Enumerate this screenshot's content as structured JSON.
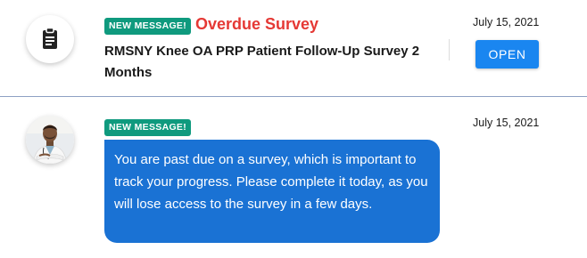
{
  "messages": [
    {
      "badge": "NEW MESSAGE!",
      "title": "Overdue Survey",
      "survey_name": "RMSNY Knee OA PRP Patient Follow-Up Survey 2 Months",
      "date": "July 15, 2021",
      "action_label": "OPEN",
      "icon": "clipboard-icon"
    },
    {
      "badge": "NEW MESSAGE!",
      "date": "July 15, 2021",
      "body": "You are past due on a survey, which is important to track your progress. Please complete it today, as you will lose access to the survey in a few days.",
      "icon": "doctor-avatar"
    }
  ],
  "colors": {
    "badge_bg": "#0f9a7e",
    "overdue_title": "#e53935",
    "open_button": "#1a86f0",
    "bubble_bg": "#1a72d4",
    "divider": "#8ea1c4"
  }
}
